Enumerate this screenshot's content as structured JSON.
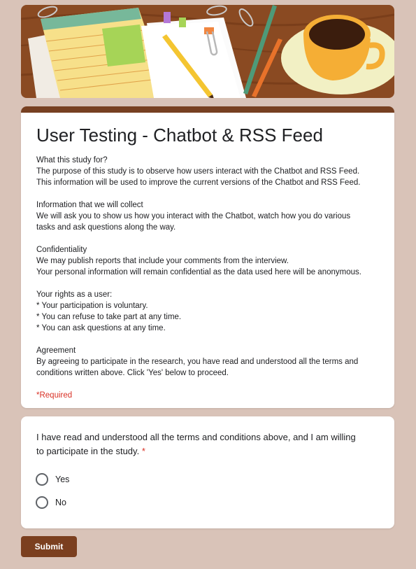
{
  "form": {
    "title": "User Testing - Chatbot & RSS Feed",
    "description": [
      [
        "What this study for?",
        "The purpose of this study is to observe how users interact with the Chatbot and RSS Feed.",
        "This information will be used to improve the current versions of the Chatbot and RSS Feed."
      ],
      [
        "Information that we will collect",
        "We will ask you to show us how you interact with the Chatbot, watch how you do various",
        "tasks and ask questions along the way."
      ],
      [
        "Confidentiality",
        "We may publish reports that include your comments from the interview.",
        "Your personal information will remain confidential as the data used here will be anonymous."
      ],
      [
        "Your rights as a user:",
        "* Your participation is voluntary.",
        "* You can refuse to take part at any time.",
        "* You can ask questions at any time."
      ],
      [
        "Agreement",
        "By agreeing to participate in the research, you have read and understood all the terms and",
        "conditions written above. Click 'Yes' below to proceed."
      ]
    ],
    "required_note": "*Required"
  },
  "question": {
    "line1": "I have read and understood all the terms and conditions above, and I am willing",
    "line2": "to participate in the study.",
    "required_marker": "*",
    "options": [
      {
        "label": "Yes",
        "selected": false
      },
      {
        "label": "No",
        "selected": false
      }
    ]
  },
  "submit_label": "Submit",
  "colors": {
    "background": "#d9c3b8",
    "accent": "#774021",
    "button": "#7b3f1f",
    "required": "#d93025"
  },
  "icons": {
    "banner": "desk-illustration-image",
    "radio": "radio-button-icon"
  }
}
